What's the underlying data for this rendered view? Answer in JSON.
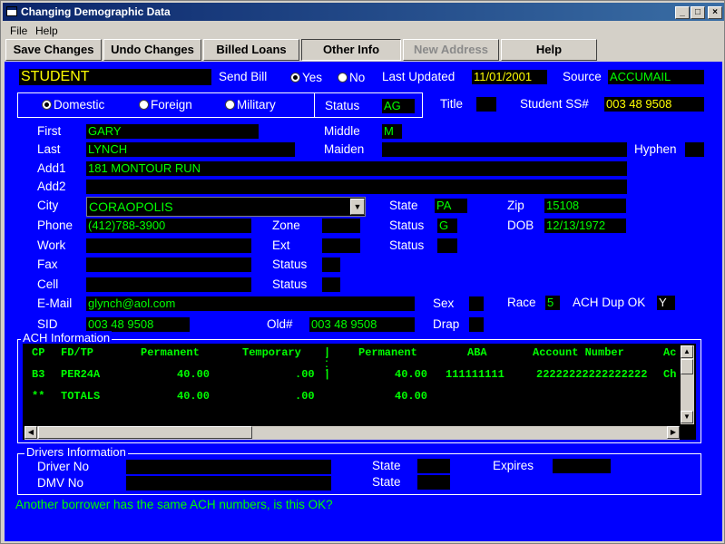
{
  "window": {
    "title": "Changing Demographic Data"
  },
  "menu": {
    "file": "File",
    "help": "Help"
  },
  "toolbar": {
    "save": "Save Changes",
    "undo": "Undo Changes",
    "billed": "Billed Loans",
    "other": "Other Info",
    "new_address": "New Address",
    "help": "Help"
  },
  "header": {
    "type_value": "STUDENT",
    "send_bill_label": "Send Bill",
    "yes_label": "Yes",
    "no_label": "No",
    "last_updated_label": "Last Updated",
    "last_updated_value": "11/01/2001",
    "source_label": "Source",
    "source_value": "ACCUMAIL"
  },
  "address_type": {
    "domestic": "Domestic",
    "foreign": "Foreign",
    "military": "Military",
    "status_label": "Status",
    "status_value": "AG",
    "selected": "Domestic"
  },
  "title_label": "Title",
  "title_value": "",
  "ssn_label": "Student SS#",
  "ssn_value": "003 48 9508",
  "person": {
    "first_label": "First",
    "first_value": "GARY",
    "middle_label": "Middle",
    "middle_value": "M",
    "last_label": "Last",
    "last_value": "LYNCH",
    "maiden_label": "Maiden",
    "maiden_value": "",
    "hyphen_label": "Hyphen",
    "hyphen_value": "",
    "add1_label": "Add1",
    "add1_value": "181 MONTOUR RUN",
    "add2_label": "Add2",
    "add2_value": "",
    "city_label": "City",
    "city_value": "CORAOPOLIS",
    "state_label": "State",
    "state_value": "PA",
    "zip_label": "Zip",
    "zip_value": "15108",
    "phone_label": "Phone",
    "phone_value": "(412)788-3900",
    "zone_label": "Zone",
    "zone_value": "",
    "phone_status_label": "Status",
    "phone_status_value": "G",
    "dob_label": "DOB",
    "dob_value": "12/13/1972",
    "work_label": "Work",
    "work_value": "",
    "ext_label": "Ext",
    "ext_value": "",
    "work_status_label": "Status",
    "work_status_value": "",
    "fax_label": "Fax",
    "fax_value": "",
    "fax_status_label": "Status",
    "fax_status_value": "",
    "cell_label": "Cell",
    "cell_value": "",
    "cell_status_label": "Status",
    "cell_status_value": "",
    "email_label": "E-Mail",
    "email_value": "glynch@aol.com",
    "sex_label": "Sex",
    "sex_value": "",
    "race_label": "Race",
    "race_value": "5",
    "ach_dup_label": "ACH Dup OK",
    "ach_dup_value": "Y",
    "sid_label": "SID",
    "sid_value": "003 48 9508",
    "old_label": "Old#",
    "old_value": "003 48 9508",
    "drap_label": "Drap",
    "drap_value": ""
  },
  "ach": {
    "title": "ACH Information",
    "headers": [
      "CP",
      "FD/TP",
      "Permanent",
      "Temporary",
      "|",
      "Permanent",
      "ABA",
      "Account Number",
      "Ac"
    ],
    "rows": [
      [
        "B3",
        "PER24A",
        "40.00",
        ".00",
        "|",
        "40.00",
        "111111111",
        "22222222222222222",
        "Ch"
      ],
      [
        "**",
        "TOTALS",
        "40.00",
        ".00",
        "",
        "40.00",
        "",
        "",
        ""
      ]
    ]
  },
  "drivers": {
    "title": "Drivers Information",
    "driver_no_label": "Driver No",
    "driver_no_value": "",
    "state1_label": "State",
    "state1_value": "",
    "expires_label": "Expires",
    "expires_value": "",
    "dmv_no_label": "DMV No",
    "dmv_no_value": "",
    "state2_label": "State",
    "state2_value": ""
  },
  "status_message": "Another borrower has the same ACH numbers, is this OK?"
}
